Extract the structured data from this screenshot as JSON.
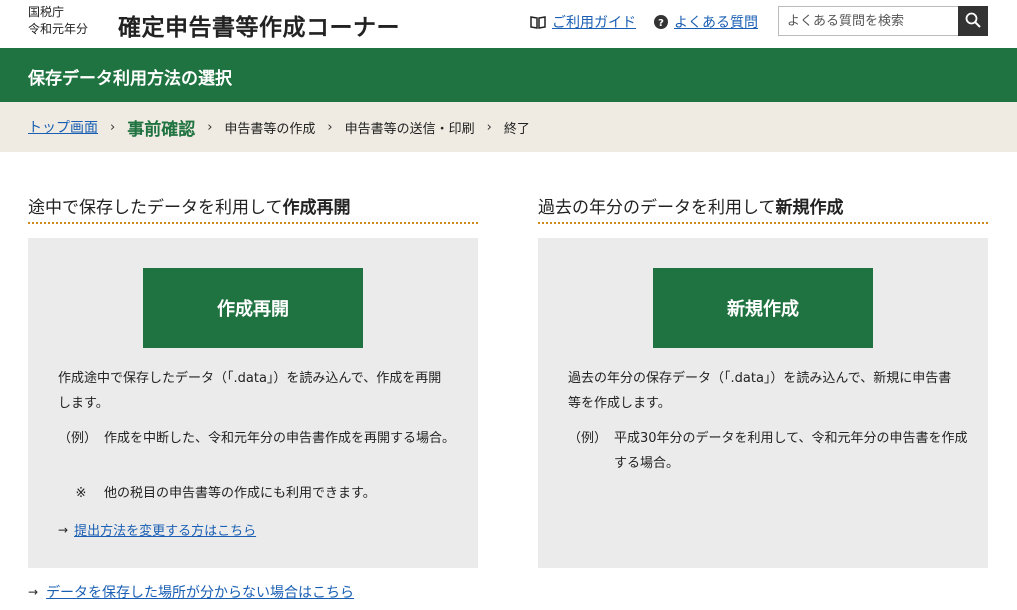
{
  "header": {
    "agency_line1": "国税庁",
    "agency_line2": "令和元年分",
    "site_title": "確定申告書等作成コーナー",
    "guide_link": "ご利用ガイド",
    "faq_link": "よくある質問",
    "search_placeholder": "よくある質問を検索"
  },
  "page_bar": {
    "title": "保存データ利用方法の選択"
  },
  "breadcrumb": {
    "top": "トップ画面",
    "current": "事前確認",
    "step3": "申告書等の作成",
    "step4": "申告書等の送信・印刷",
    "step5": "終了"
  },
  "left": {
    "heading_prefix": "途中で保存したデータを利用して",
    "heading_bold": "作成再開",
    "button": "作成再開",
    "desc": "作成途中で保存したデータ（「.data」）を読み込んで、作成を再開します。",
    "ex_label": "（例）",
    "ex_text": "作成を中断した、令和元年分の申告書作成を再開する場合。",
    "note_mark": "※",
    "note_text": "他の税目の申告書等の作成にも利用できます。",
    "link": "提出方法を変更する方はこちら"
  },
  "right": {
    "heading_prefix": "過去の年分のデータを利用して",
    "heading_bold": "新規作成",
    "button": "新規作成",
    "desc": "過去の年分の保存データ（「.data」）を読み込んで、新規に申告書等を作成します。",
    "ex_label": "（例）",
    "ex_text": "平成30年分のデータを利用して、令和元年分の申告書を作成する場合。"
  },
  "bottom_link": "データを保存した場所が分からない場合はこちら",
  "colors": {
    "primary_green": "#1f7340",
    "link_blue": "#1a5fb4",
    "breadcrumb_bg": "#efebe2",
    "panel_bg": "#ebebeb",
    "heading_underline": "#d18a1c"
  }
}
